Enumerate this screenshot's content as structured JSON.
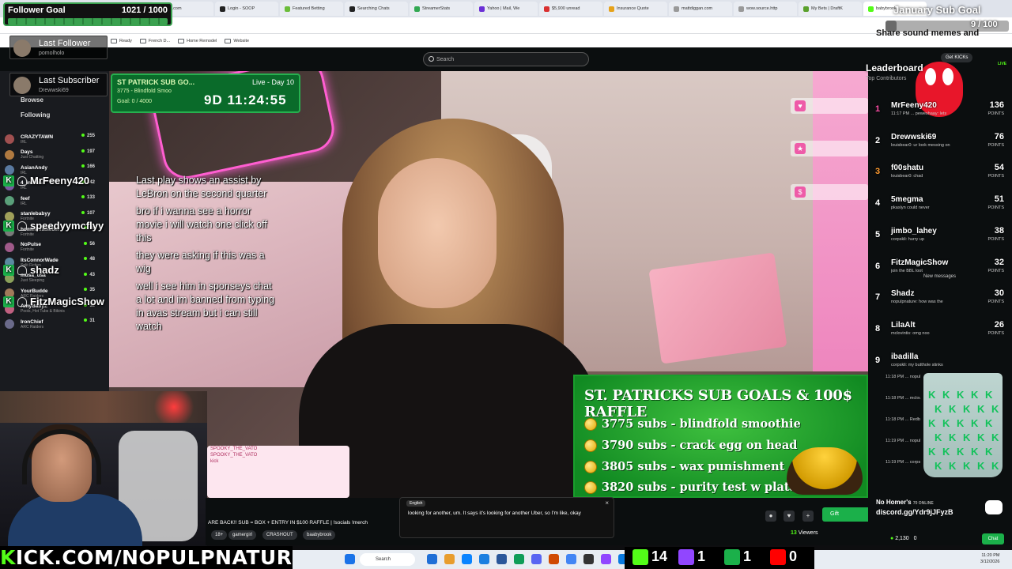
{
  "browser": {
    "tabs": [
      {
        "label": "tlash.com",
        "color": "#3b7dd8"
      },
      {
        "label": "Login - SOOP",
        "color": "#222222"
      },
      {
        "label": "Featured Betting",
        "color": "#6bbd3a"
      },
      {
        "label": "Searching Chats",
        "color": "#222222"
      },
      {
        "label": "StreamerStats",
        "color": "#32a852"
      },
      {
        "label": "Yahoo | Mail, We",
        "color": "#6b2fd6"
      },
      {
        "label": "$5,900 unread",
        "color": "#d93030"
      },
      {
        "label": "Insurance Quote",
        "color": "#e6a21a"
      },
      {
        "label": "mattdiggan.com",
        "color": "#999999"
      },
      {
        "label": "wow.source.http",
        "color": "#999999"
      },
      {
        "label": "My Bets | DraftK",
        "color": "#5aa02c"
      },
      {
        "label": "babybrook",
        "color": "#53fc18"
      }
    ],
    "bookmarks": [
      "Ready",
      "French D...",
      "Home Remodel",
      "Website"
    ]
  },
  "kick": {
    "search_placeholder": "Search",
    "get_kicks": "Get KICKs",
    "live": "LIVE",
    "sidebar": {
      "browse": "Browse",
      "following": "Following",
      "items": [
        {
          "name": "CRAZYTAWN",
          "category": "IRL",
          "count": "255"
        },
        {
          "name": "Days",
          "category": "Just Chatting",
          "count": "197"
        },
        {
          "name": "AsianAndy",
          "category": "IRL",
          "count": "166"
        },
        {
          "name": "4_inches",
          "category": "IRL",
          "count": "142"
        },
        {
          "name": "feef",
          "category": "IRL",
          "count": "133"
        },
        {
          "name": "stanlebabyy",
          "category": "Fortnite",
          "count": "107"
        },
        {
          "name": "homelessbieber",
          "category": "Fortnite",
          "count": "98"
        },
        {
          "name": "NoPulse",
          "category": "Fortnite",
          "count": "56"
        },
        {
          "name": "ItsConnorWade",
          "category": "Split Fiction",
          "count": "48"
        },
        {
          "name": "musa_usa",
          "category": "Just Sleeping",
          "count": "43"
        },
        {
          "name": "YourBudde",
          "category": "ARC Raiders",
          "count": "35"
        },
        {
          "name": "AmyBabyZ",
          "category": "Pools, Hot Tubs & Bikinis",
          "count": "32"
        },
        {
          "name": "IronChief",
          "category": "ARC Raiders",
          "count": "31"
        }
      ]
    }
  },
  "overlay": {
    "follower_goal": {
      "title": "Follower Goal",
      "count": "1021 / 1000",
      "progress": 1.0
    },
    "sub_goal": {
      "title": "January Sub Goal",
      "count": "9 / 100",
      "progress": 0.09
    },
    "share_text": "Share sound memes and",
    "last_follower": {
      "label": "Last Follower",
      "name": "pomolholo"
    },
    "last_subscriber": {
      "label": "Last Subscriber",
      "name": "Drewwski69"
    },
    "timer": {
      "title": "ST PATRICK SUB GO...",
      "day": "Live - Day 10",
      "line": "3775 - Blindfold Smoo",
      "goal": "Goal: 0 / 4000",
      "countdown": "9D 11:24:55"
    },
    "chat_lines": [
      "Last play shows an assist by LeBron on the second quarter",
      "bro if i wanna see a horror movie i will watch one click off this",
      "they were asking if this was a wig",
      "well i see him in sponseys chat a lot and im banned from typing in avas stream but i can still watch"
    ],
    "name_tags": [
      "MrFeeny420",
      "speedyymcflyy",
      "shadz",
      "FitzMagicShow"
    ],
    "raffle": {
      "title": "ST. PATRICKS SUB GOALS & 100$ RAFFLE",
      "rows": [
        "3775 subs - blindfold smoothie",
        "3790 subs - crack egg on head",
        "3805 subs - wax punishment",
        "3820 subs - purity test w platano boy"
      ]
    },
    "mini_chat": [
      "SPOOKY_THE_VATO",
      "SPOOKY_THE_VATO",
      "kick"
    ],
    "url_banner_k": "K",
    "url_banner": "ICK.COM/NOPULPNATURE",
    "socials": [
      {
        "value": "14",
        "color": "#53fc18"
      },
      {
        "value": "1",
        "color": "#9146ff"
      },
      {
        "value": "1",
        "color": "#1bb04a"
      },
      {
        "value": "0",
        "color": "#ff0000"
      }
    ]
  },
  "leaderboard": {
    "title": "Leaderboard",
    "subtitle": "Top Contributors",
    "points_label": "POINTS",
    "rows": [
      {
        "rank": "1",
        "name": "MrFeeny420",
        "points": "136",
        "chat": "11:17 PM ... peweshaay: lets"
      },
      {
        "rank": "2",
        "name": "Drewwski69",
        "points": "76",
        "chat": "louisbear0: ur look messing on"
      },
      {
        "rank": "3",
        "name": "f00shatu",
        "points": "54",
        "chat": "louisbear0: chad"
      },
      {
        "rank": "4",
        "name": "5megma",
        "points": "51",
        "chat": "pkaslyn could never"
      },
      {
        "rank": "5",
        "name": "jimbo_lahey",
        "points": "38",
        "chat": "corpskli: hurry up"
      },
      {
        "rank": "6",
        "name": "FitzMagicShow",
        "points": "32",
        "chat": "join the BBL loot"
      },
      {
        "rank": "7",
        "name": "Shadz",
        "points": "30",
        "chat": "nopulpnature: how was the"
      },
      {
        "rank": "8",
        "name": "LilaAlt",
        "points": "26",
        "chat": "mclovintis: omg noo"
      },
      {
        "rank": "9",
        "name": "ibadilla",
        "points": "",
        "chat": "corpskli: my butthole stinks"
      }
    ],
    "new_messages": "New messages",
    "chat": [
      "11:18 PM ... nopulpnature: ur live",
      "11:18 PM ... mclovintis",
      "11:18 PM ... RedbottomBandit",
      "11:19 PM ... nopulpnature",
      "11:19 PM ... corpskli"
    ]
  },
  "stream": {
    "title": "ARE BACK!! SUB = BOX + ENTRY IN $100 RAFFLE | !socials !merch",
    "tags": [
      "18+",
      "gamergirl",
      "CRASHOUT",
      "baabybrook"
    ],
    "caption_lang": "English",
    "caption": "looking for another, um. It says it's looking for another Uber, so I'm like, okay",
    "gift_label": "Gift",
    "viewers_count": "13",
    "viewers_label": "Viewers",
    "kicks": "2,130",
    "kicks_other": "0",
    "chat_label": "Chat"
  },
  "discord": {
    "top": "No Homer's",
    "status": "70 ONLINE",
    "url": "discord.gg/Ydr9jJFyzB"
  },
  "taskbar": {
    "search": "Search",
    "time": "11:20 PM",
    "date": "3/12/2026"
  }
}
